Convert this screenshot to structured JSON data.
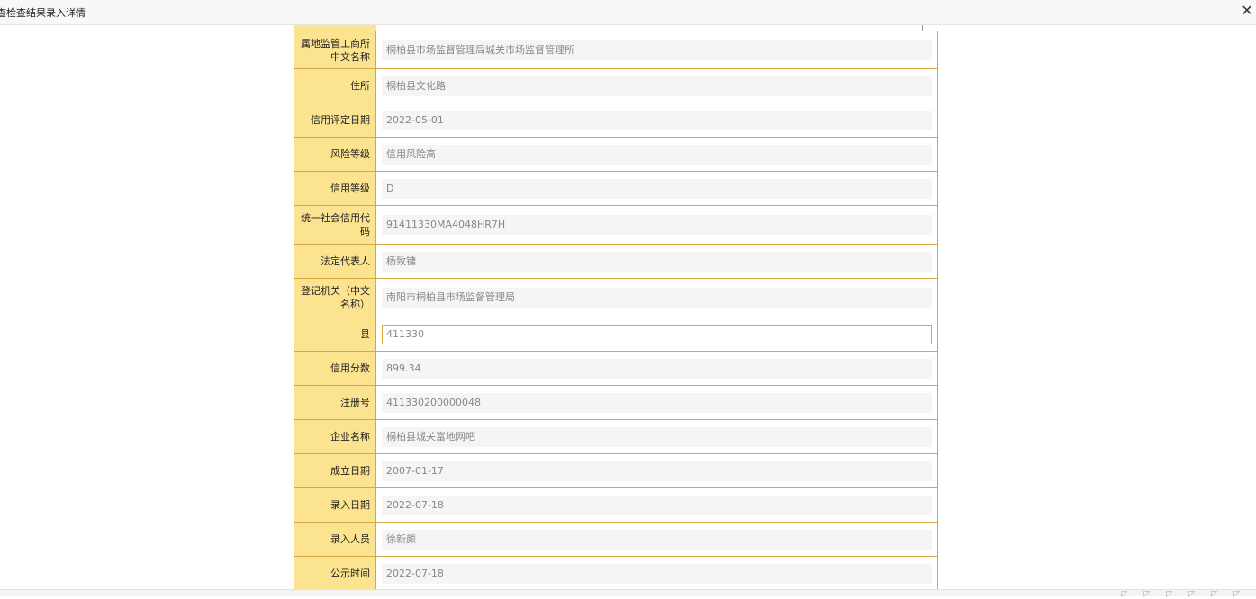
{
  "window": {
    "title": "查检查结果录入详情",
    "close_glyph": "✕"
  },
  "rows": [
    {
      "label": "属地监管工商所中文名称",
      "value": "桐柏县市场监督管理局城关市场监督管理所"
    },
    {
      "label": "住所",
      "value": "桐柏县文化路"
    },
    {
      "label": "信用评定日期",
      "value": "2022-05-01"
    },
    {
      "label": "风险等级",
      "value": "信用风险高"
    },
    {
      "label": "信用等级",
      "value": "D"
    },
    {
      "label": "统一社会信用代码",
      "value": "91411330MA4048HR7H"
    },
    {
      "label": "法定代表人",
      "value": "杨致镛"
    },
    {
      "label": "登记机关（中文名称）",
      "value": "南阳市桐柏县市场监督管理局"
    },
    {
      "label": "县",
      "value": "411330"
    },
    {
      "label": "信用分数",
      "value": "899.34"
    },
    {
      "label": "注册号",
      "value": "411330200000048"
    },
    {
      "label": "企业名称",
      "value": "桐柏县城关富地网吧"
    },
    {
      "label": "成立日期",
      "value": "2007-01-17"
    },
    {
      "label": "录入日期",
      "value": "2022-07-18"
    },
    {
      "label": "录入人员",
      "value": "徐新颜"
    },
    {
      "label": "公示时间",
      "value": "2022-07-18"
    }
  ],
  "colors": {
    "label_bg": "#fbe390",
    "border": "#d4a843",
    "value_bg": "#f5f5f5",
    "focus_border": "#e0a93a"
  },
  "bottombar": {
    "icon_names": [
      "share-icon",
      "comment-icon",
      "save-icon",
      "print-icon",
      "fullscreen-icon",
      "collapse-icon"
    ]
  }
}
